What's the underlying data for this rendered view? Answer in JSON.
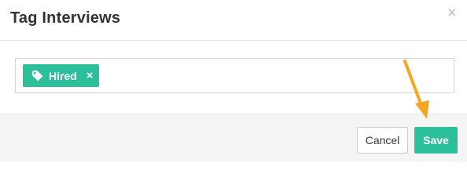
{
  "dialog": {
    "title": "Tag Interviews",
    "close_glyph": "×"
  },
  "tags": [
    {
      "label": "Hired",
      "remove_glyph": "×",
      "icon": "tag-icon"
    }
  ],
  "footer": {
    "cancel_label": "Cancel",
    "save_label": "Save"
  },
  "colors": {
    "accent": "#2bbf9a",
    "annotation_arrow": "#f5a623"
  }
}
